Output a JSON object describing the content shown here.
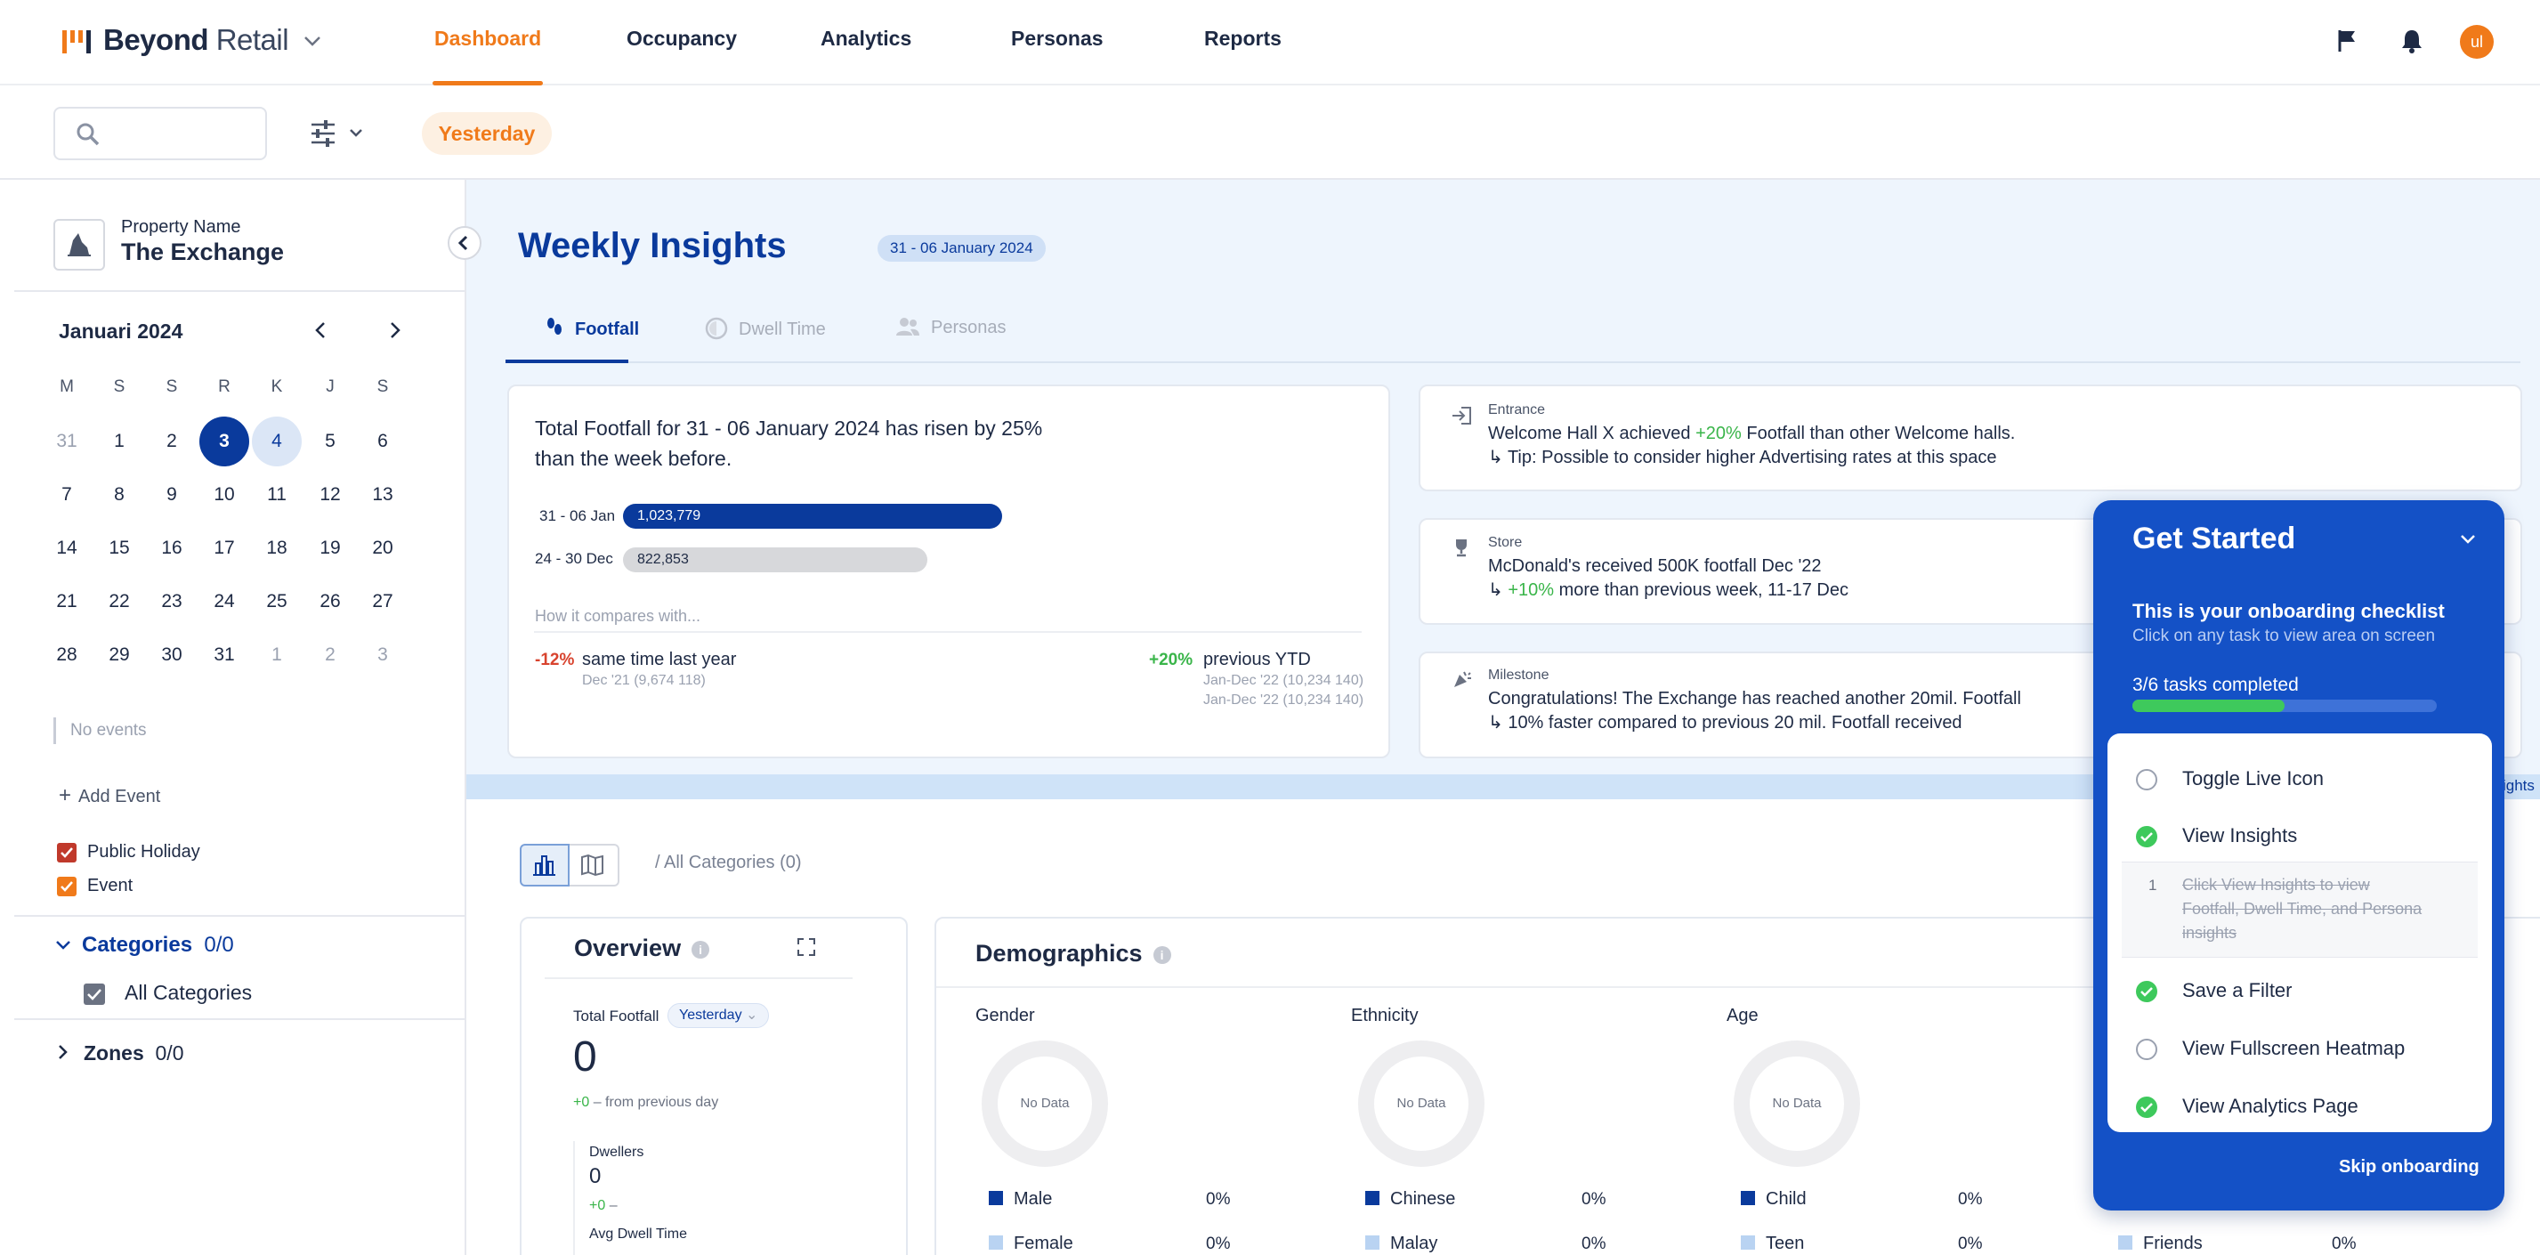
{
  "brand": {
    "name_bold": "Beyond",
    "name_light": "Retail"
  },
  "nav": {
    "items": [
      "Dashboard",
      "Occupancy",
      "Analytics",
      "Personas",
      "Reports"
    ],
    "active": "Dashboard"
  },
  "user": {
    "initials": "ul"
  },
  "toolbar": {
    "search_placeholder": "",
    "date_filter": "Yesterday"
  },
  "property": {
    "label": "Property Name",
    "name": "The Exchange"
  },
  "calendar": {
    "title": "Januari 2024",
    "days_of_week": [
      "M",
      "S",
      "S",
      "R",
      "K",
      "J",
      "S"
    ],
    "weeks": [
      [
        "31",
        "1",
        "2",
        "3",
        "4",
        "5",
        "6"
      ],
      [
        "7",
        "8",
        "9",
        "10",
        "11",
        "12",
        "13"
      ],
      [
        "14",
        "15",
        "16",
        "17",
        "18",
        "19",
        "20"
      ],
      [
        "21",
        "22",
        "23",
        "24",
        "25",
        "26",
        "27"
      ],
      [
        "28",
        "29",
        "30",
        "31",
        "1",
        "2",
        "3"
      ]
    ],
    "selected": "3",
    "highlighted": "4"
  },
  "events": {
    "empty_text": "No events",
    "add_label": "Add Event",
    "legend": [
      {
        "label": "Public Holiday",
        "color": "#c0392b"
      },
      {
        "label": "Event",
        "color": "#f07a1a"
      }
    ]
  },
  "categories": {
    "label": "Categories",
    "count": "0/0",
    "all_label": "All Categories"
  },
  "zones": {
    "label": "Zones",
    "count": "0/0"
  },
  "insights": {
    "title": "Weekly Insights",
    "range_chip": "31 - 06 January 2024",
    "tabs": [
      "Footfall",
      "Dwell Time",
      "Personas"
    ],
    "active_tab": "Footfall",
    "summary_line1": "Total Footfall for 31 - 06 January 2024 has risen by 25%",
    "summary_line2": "than the week before.",
    "bars": [
      {
        "label": "31 - 06 Jan",
        "value_text": "1,023,779",
        "value": 1023779
      },
      {
        "label": "24 - 30 Dec",
        "value_text": "822,853",
        "value": 822853
      }
    ],
    "compare_heading": "How it compares with...",
    "compare_left": {
      "delta": "-12%",
      "title": "same time last year",
      "detail": "Dec '21 (9,674 118)"
    },
    "compare_right": {
      "delta": "+20%",
      "title": "previous YTD",
      "detail1": "Jan-Dec '22 (10,234 140)",
      "detail2": "Jan-Dec '22 (10,234 140)"
    },
    "cards": [
      {
        "category": "Entrance",
        "line1_pre": "Welcome Hall X achieved ",
        "line1_hl": "+20%",
        "line1_post": " Footfall than other Welcome halls.",
        "line2": "↳ Tip: Possible to consider higher Advertising rates at this space"
      },
      {
        "category": "Store",
        "line1": "McDonald's received 500K footfall Dec '22",
        "line2_pre": "↳ ",
        "line2_hl": "+10%",
        "line2_post": " more than previous week, 11-17 Dec"
      },
      {
        "category": "Milestone",
        "line1": "Congratulations! The Exchange has reached another 20mil. Footfall",
        "line2": "↳ 10% faster compared to previous 20 mil. Footfall received"
      }
    ],
    "edge_text": "ights"
  },
  "lower": {
    "crumb": "/ All Categories (0)",
    "overview": {
      "title": "Overview",
      "total_label": "Total Footfall",
      "period": "Yesterday",
      "total_value": "0",
      "change_pos": "+0",
      "change_text": " – from previous day",
      "dwellers_label": "Dwellers",
      "dwellers_value": "0",
      "dwellers_change": "+0",
      "dwellers_dash": " –",
      "avg_label": "Avg Dwell Time"
    },
    "demographics": {
      "title": "Demographics",
      "no_data": "No Data",
      "groups": [
        {
          "name": "Gender",
          "rows": [
            {
              "label": "Male",
              "pct": "0%",
              "color": "#0a3a9c"
            },
            {
              "label": "Female",
              "pct": "0%",
              "color": "#b9d3f2"
            }
          ]
        },
        {
          "name": "Ethnicity",
          "rows": [
            {
              "label": "Chinese",
              "pct": "0%",
              "color": "#0a3a9c"
            },
            {
              "label": "Malay",
              "pct": "0%",
              "color": "#b9d3f2"
            }
          ]
        },
        {
          "name": "Age",
          "rows": [
            {
              "label": "Child",
              "pct": "0%",
              "color": "#0a3a9c"
            },
            {
              "label": "Teen",
              "pct": "0%",
              "color": "#b9d3f2"
            }
          ]
        },
        {
          "name": "",
          "rows": [
            {
              "label": "Friends",
              "pct": "0%",
              "color": "#b9d3f2"
            }
          ]
        }
      ]
    }
  },
  "onboarding": {
    "title": "Get Started",
    "subtitle": "This is your onboarding checklist",
    "hint": "Click on any task to view area on screen",
    "progress_text": "3/6 tasks completed",
    "progress_fraction": 0.5,
    "tasks": [
      {
        "label": "Toggle Live Icon",
        "done": false
      },
      {
        "label": "View Insights",
        "done": true
      },
      {
        "label": "Save a Filter",
        "done": true
      },
      {
        "label": "View Fullscreen Heatmap",
        "done": false
      },
      {
        "label": "View Analytics Page",
        "done": true
      }
    ],
    "subtask": {
      "num": "1",
      "line1": "Click View Insights to view",
      "line2": "Footfall, Dwell Time, and Persona",
      "line3": "insights"
    },
    "skip_label": "Skip onboarding",
    "accent": "#1451c6",
    "done_color": "#3ec95c"
  }
}
